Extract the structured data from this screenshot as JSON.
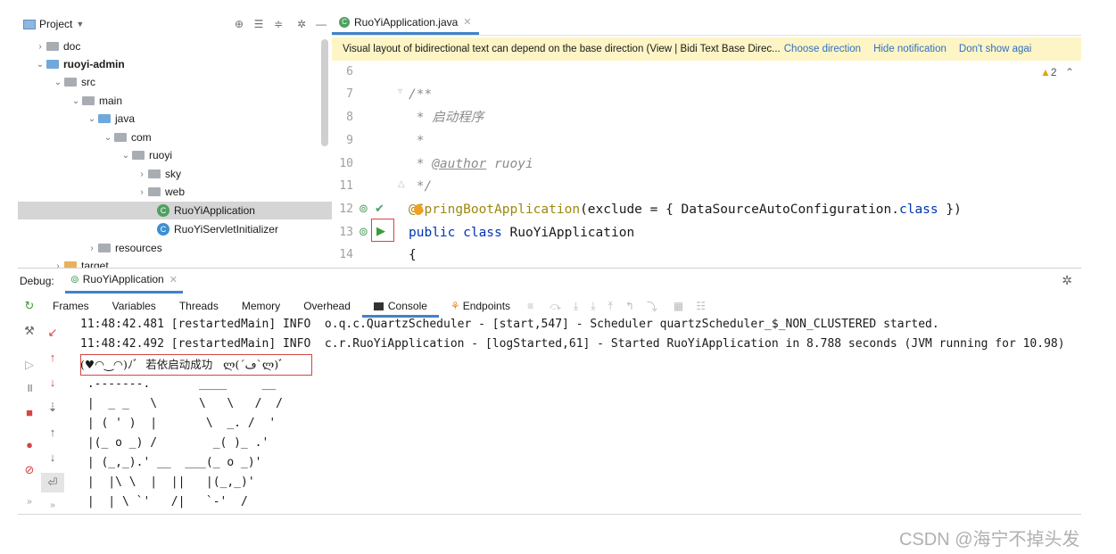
{
  "project": {
    "header_label": "Project",
    "tree": [
      {
        "label": "doc",
        "chev": "›"
      },
      {
        "label": "ruoyi-admin",
        "chev": "⌄"
      },
      {
        "label": "src",
        "chev": "⌄"
      },
      {
        "label": "main",
        "chev": "⌄"
      },
      {
        "label": "java",
        "chev": "⌄"
      },
      {
        "label": "com",
        "chev": "⌄"
      },
      {
        "label": "ruoyi",
        "chev": "⌄"
      },
      {
        "label": "sky",
        "chev": "›"
      },
      {
        "label": "web",
        "chev": "›"
      },
      {
        "label": "RuoYiApplication",
        "chev": ""
      },
      {
        "label": "RuoYiServletInitializer",
        "chev": ""
      },
      {
        "label": "resources",
        "chev": "›"
      },
      {
        "label": "target",
        "chev": "›"
      }
    ]
  },
  "editor": {
    "tab_label": "RuoYiApplication.java",
    "notification": {
      "text": "Visual layout of bidirectional text can depend on the base direction (View | Bidi Text Base Direc...",
      "choose": "Choose direction",
      "hide": "Hide notification",
      "dont_show": "Don't show agai"
    },
    "warning_count": "2",
    "line_numbers": [
      "6",
      "7",
      "8",
      "9",
      "10",
      "11",
      "12",
      "13",
      "14"
    ],
    "code": {
      "l7": "/**",
      "l8": " * 启动程序",
      "l9": " *",
      "l10_pre": " * ",
      "l10_tag": "@author",
      "l10_post": " ruoyi",
      "l11": " */",
      "l12_ann": "@SpringBootApplication",
      "l12_mid": "(exclude = { DataSourceAutoConfiguration.",
      "l12_kw": "class",
      "l12_end": " })",
      "l13_kw": "public class ",
      "l13_name": "RuoYiApplication",
      "l14": "{"
    }
  },
  "debug": {
    "label": "Debug:",
    "session_tab": "RuoYiApplication",
    "tabs": [
      "Frames",
      "Variables",
      "Threads",
      "Memory",
      "Overhead",
      "Console",
      "Endpoints"
    ],
    "console_lines": [
      "11:48:42.481 [restartedMain] INFO  o.q.c.QuartzScheduler - [start,547] - Scheduler quartzScheduler_$_NON_CLUSTERED started.",
      "11:48:42.492 [restartedMain] INFO  c.r.RuoYiApplication - [logStarted,61] - Started RuoYiApplication in 8.788 seconds (JVM running for 10.98)",
      "(♥◠‿◠)ﾉﾞ  若依启动成功   ლ(´ڡ`ლ)ﾞ",
      " .-------.       ____     __",
      " |  _ _   \\      \\   \\   /  /",
      " | ( ' )  |       \\  _. /  '",
      " |(_ o _) /        _( )_ .'",
      " | (_,_).' __  ___(_ o _)'",
      " |  |\\ \\  |  ||   |(_,_)'",
      " |  | \\ `'   /|   `-'  /"
    ]
  },
  "watermark": "CSDN @海宁不掉头发",
  "colors": {
    "accent": "#4083c9",
    "highlight_box": "#d64541",
    "notification_bg": "#fdf5c5"
  }
}
